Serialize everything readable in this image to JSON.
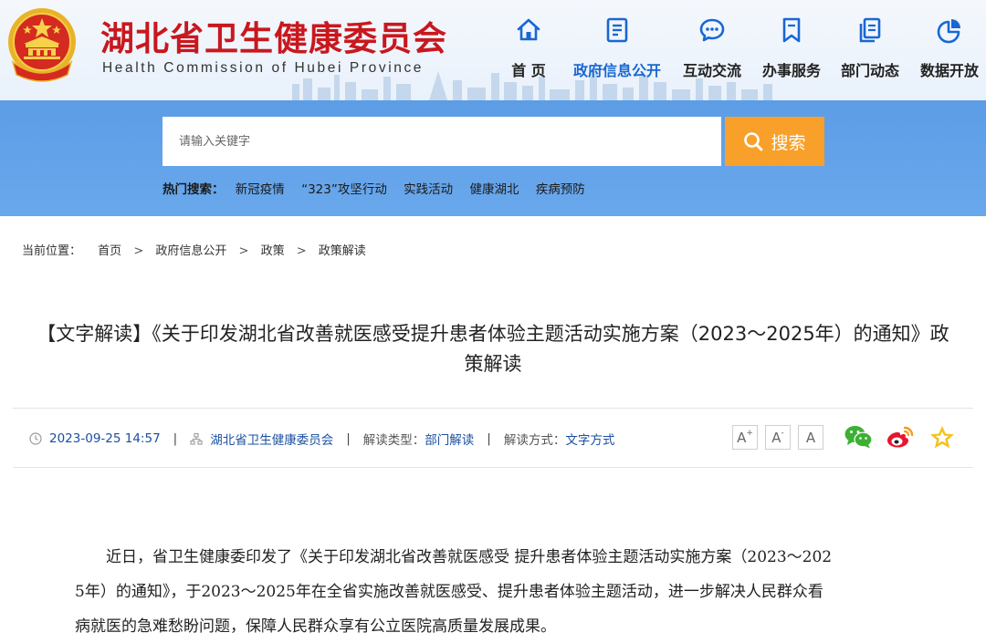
{
  "header": {
    "title": "湖北省卫生健康委员会",
    "subtitle": "Health Commission of Hubei Province"
  },
  "nav": [
    {
      "label": "首 页",
      "icon": "home-icon"
    },
    {
      "label": "政府信息公开",
      "icon": "document-list-icon",
      "active": true
    },
    {
      "label": "互动交流",
      "icon": "chat-bubble-icon"
    },
    {
      "label": "办事服务",
      "icon": "bookmark-icon"
    },
    {
      "label": "部门动态",
      "icon": "copy-document-icon"
    },
    {
      "label": "数据开放",
      "icon": "pie-chart-icon"
    }
  ],
  "search": {
    "placeholder": "请输入关键字",
    "button_label": "搜索",
    "hot_label": "热门搜索：",
    "hot_terms": [
      "新冠疫情",
      "“323”攻坚行动",
      "实践活动",
      "健康湖北",
      "疾病预防"
    ]
  },
  "breadcrumb": {
    "label": "当前位置：",
    "items": [
      "首页",
      "政府信息公开",
      "政策",
      "政策解读"
    ],
    "separator": ">"
  },
  "article": {
    "title_line1": "【文字解读】《关于印发湖北省改善就医感受提升患者体验主题活动实施方案（2023～2025年）的通知》政",
    "title_line2": "策解读",
    "date": "2023-09-25 14:57",
    "source": "湖北省卫生健康委员会",
    "type_label": "解读类型：",
    "type_value": "部门解读",
    "method_label": "解读方式：",
    "method_value": "文字方式",
    "separator": "|",
    "font_buttons": [
      "A+",
      "A-",
      "A"
    ],
    "share_icons": [
      "wechat-icon",
      "weibo-icon",
      "favorite-star-icon"
    ],
    "paragraph_lines": [
      "　　近日，省卫生健康委印发了《关于印发湖北省改善就医感受 提升患者体验主题活动实施方案（2023～202",
      "5年）的通知》，于2023～2025年在全省实施改善就医感受、提升患者体验主题活动，进一步解决人民群众看",
      "病就医的急难愁盼问题，保障人民群众享有公立医院高质量发展成果。"
    ]
  },
  "colors": {
    "brand_red": "#c8181e",
    "nav_active": "#1967d2",
    "band_blue": "#5e9ee6",
    "search_button": "#f8a02a",
    "link_blue": "#1a4fa0"
  }
}
